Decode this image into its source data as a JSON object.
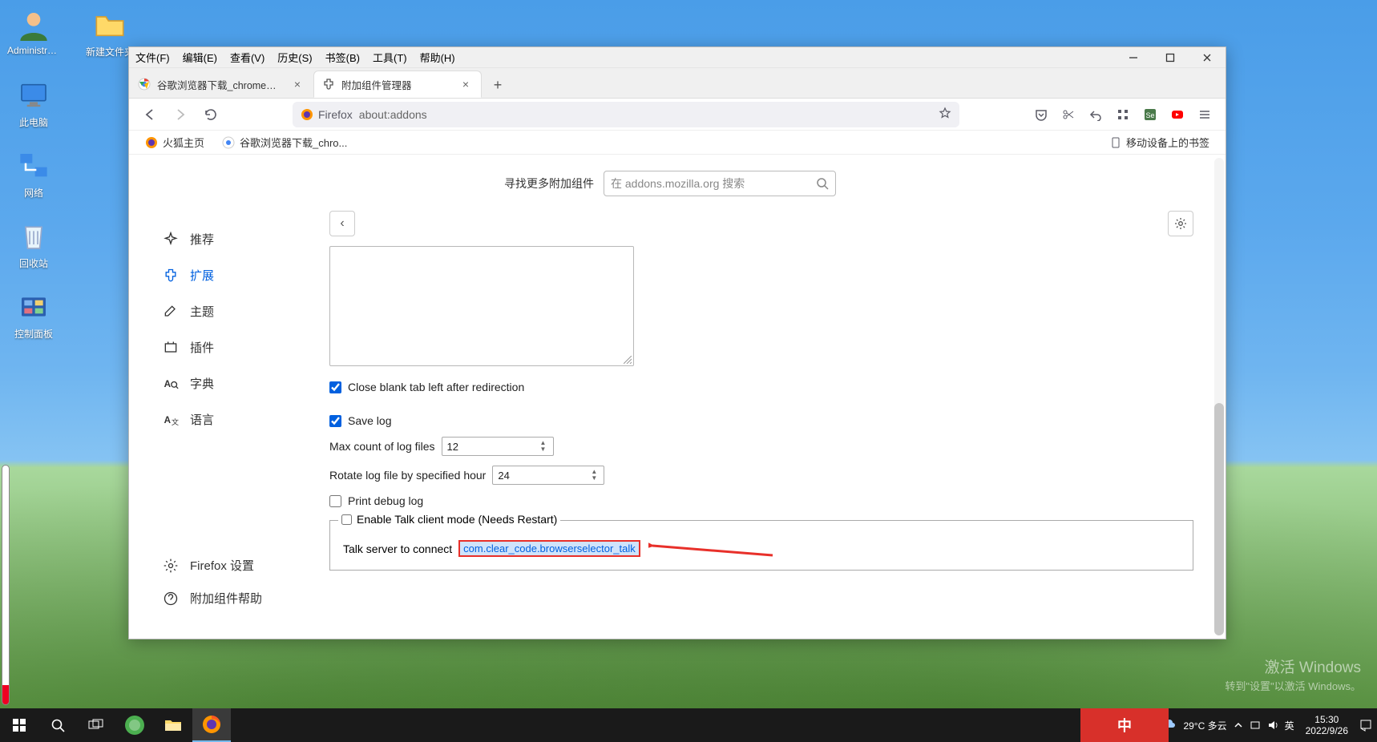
{
  "desktop": {
    "icons": [
      {
        "label": "Administra..."
      },
      {
        "label": "新建文件夹"
      },
      {
        "label": "此电脑"
      },
      {
        "label": "网络"
      },
      {
        "label": "回收站"
      },
      {
        "label": "控制面板"
      }
    ]
  },
  "watermark": {
    "l1": "激活 Windows",
    "l2": "转到\"设置\"以激活 Windows。"
  },
  "taskbar": {
    "weather": "29°C 多云",
    "ime": "英",
    "time": "15:30",
    "date": "2022/9/26"
  },
  "window": {
    "menu": [
      "文件(F)",
      "编辑(E)",
      "查看(V)",
      "历史(S)",
      "书签(B)",
      "工具(T)",
      "帮助(H)"
    ],
    "tabs": [
      {
        "label": "谷歌浏览器下载_chrome浏览器",
        "active": false
      },
      {
        "label": "附加组件管理器",
        "active": true
      }
    ],
    "url": {
      "identity": "Firefox",
      "address": "about:addons"
    },
    "bookmarks": {
      "items": [
        {
          "label": "火狐主页"
        },
        {
          "label": "谷歌浏览器下载_chro..."
        }
      ],
      "mobile": "移动设备上的书签"
    },
    "addons": {
      "search_label": "寻找更多附加组件",
      "search_placeholder": "在 addons.mozilla.org 搜索",
      "sidebar": [
        {
          "key": "recommend",
          "label": "推荐"
        },
        {
          "key": "extensions",
          "label": "扩展"
        },
        {
          "key": "themes",
          "label": "主题"
        },
        {
          "key": "plugins",
          "label": "插件"
        },
        {
          "key": "dict",
          "label": "字典"
        },
        {
          "key": "lang",
          "label": "语言"
        }
      ],
      "footer": [
        {
          "label": "Firefox 设置"
        },
        {
          "label": "附加组件帮助"
        }
      ],
      "options": {
        "close_blank": "Close blank tab left after redirection",
        "save_log": "Save log",
        "max_log_label": "Max count of log files",
        "max_log_value": "12",
        "rotate_label": "Rotate log file by specified hour",
        "rotate_value": "24",
        "print_debug": "Print debug log",
        "talk_mode": "Enable Talk client mode (Needs Restart)",
        "talk_server_label": "Talk server to connect",
        "talk_server_value": "com.clear_code.browserselector_talk"
      }
    }
  }
}
